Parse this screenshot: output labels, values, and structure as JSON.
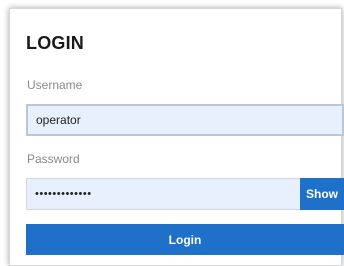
{
  "login": {
    "title": "LOGIN",
    "username_label": "Username",
    "username_value": "operator",
    "password_label": "Password",
    "password_value": "•••••••••••••",
    "show_label": "Show",
    "submit_label": "Login"
  },
  "colors": {
    "accent": "#1e70c9",
    "field_bg": "#e8f0fe",
    "label_text": "#8a8a8a"
  }
}
